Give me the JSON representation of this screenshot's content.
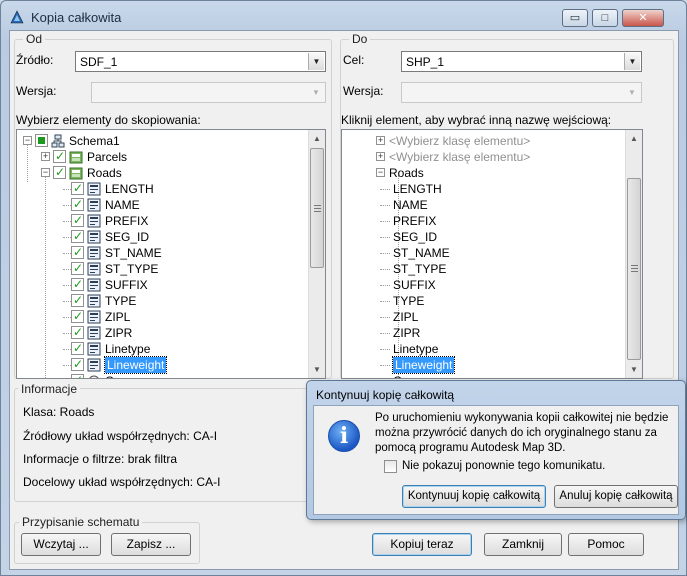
{
  "window": {
    "title": "Kopia całkowita",
    "minimize_glyph": "▭",
    "maximize_glyph": "□",
    "close_glyph": "✕"
  },
  "left": {
    "group_label": "Od",
    "source_label": "Źródło:",
    "source_value": "SDF_1",
    "version_label": "Wersja:",
    "version_value": "",
    "tree_label": "Wybierz elementy do skopiowania:",
    "tree_items": [
      {
        "label": "Schema1",
        "level": 0,
        "expander": "−",
        "check": "partial",
        "icon": "schema-icon"
      },
      {
        "label": "Parcels",
        "level": 1,
        "expander": "+",
        "check": "checked",
        "icon": "feature-class-icon"
      },
      {
        "label": "Roads",
        "level": 1,
        "expander": "−",
        "check": "checked",
        "icon": "feature-class-icon"
      },
      {
        "label": "LENGTH",
        "level": 2,
        "check": "checked",
        "icon": "property-icon"
      },
      {
        "label": "NAME",
        "level": 2,
        "check": "checked",
        "icon": "property-icon"
      },
      {
        "label": "PREFIX",
        "level": 2,
        "check": "checked",
        "icon": "property-icon"
      },
      {
        "label": "SEG_ID",
        "level": 2,
        "check": "checked",
        "icon": "property-icon"
      },
      {
        "label": "ST_NAME",
        "level": 2,
        "check": "checked",
        "icon": "property-icon"
      },
      {
        "label": "ST_TYPE",
        "level": 2,
        "check": "checked",
        "icon": "property-icon"
      },
      {
        "label": "SUFFIX",
        "level": 2,
        "check": "checked",
        "icon": "property-icon"
      },
      {
        "label": "TYPE",
        "level": 2,
        "check": "checked",
        "icon": "property-icon"
      },
      {
        "label": "ZIPL",
        "level": 2,
        "check": "checked",
        "icon": "property-icon"
      },
      {
        "label": "ZIPR",
        "level": 2,
        "check": "checked",
        "icon": "property-icon"
      },
      {
        "label": "Linetype",
        "level": 2,
        "check": "checked",
        "icon": "property-icon"
      },
      {
        "label": "Lineweight",
        "level": 2,
        "check": "checked",
        "icon": "property-icon",
        "selected": true
      },
      {
        "label": "Geom",
        "level": 2,
        "check": "checked",
        "icon": "geometry-icon",
        "partial_visible": true
      }
    ]
  },
  "right": {
    "group_label": "Do",
    "target_label": "Cel:",
    "target_value": "SHP_1",
    "version_label": "Wersja:",
    "version_value": "",
    "tree_label": "Kliknij element, aby wybrać inną nazwę wejściową:",
    "tree_items": [
      {
        "label": "<Wybierz klasę elementu>",
        "level": 0,
        "expander": "+",
        "gray": true
      },
      {
        "label": "<Wybierz klasę elementu>",
        "level": 0,
        "expander": "+",
        "gray": true
      },
      {
        "label": "Roads",
        "level": 0,
        "expander": "−"
      },
      {
        "label": "LENGTH",
        "level": 1
      },
      {
        "label": "NAME",
        "level": 1
      },
      {
        "label": "PREFIX",
        "level": 1
      },
      {
        "label": "SEG_ID",
        "level": 1
      },
      {
        "label": "ST_NAME",
        "level": 1
      },
      {
        "label": "ST_TYPE",
        "level": 1
      },
      {
        "label": "SUFFIX",
        "level": 1
      },
      {
        "label": "TYPE",
        "level": 1
      },
      {
        "label": "ZIPL",
        "level": 1
      },
      {
        "label": "ZIPR",
        "level": 1
      },
      {
        "label": "Linetype",
        "level": 1
      },
      {
        "label": "Lineweight",
        "level": 1,
        "selected": true
      },
      {
        "label": "Geom",
        "level": 1,
        "partial_visible": true
      }
    ]
  },
  "info": {
    "group_label": "Informacje",
    "class_line": "Klasa: Roads",
    "source_cs_line": "Źródłowy układ współrzędnych: CA-I",
    "filter_line": "Informacje o filtrze: brak filtra",
    "target_cs_line": "Docelowy układ współrzędnych: CA-I"
  },
  "schema_mapping": {
    "group_label": "Przypisanie schematu",
    "load_button": "Wczytaj ...",
    "save_button": "Zapisz ..."
  },
  "footer": {
    "copy_now_button": "Kopiuj teraz",
    "close_button": "Zamknij",
    "help_button": "Pomoc"
  },
  "popup": {
    "title": "Kontynuuj kopię całkowitą",
    "message": "Po uruchomieniu wykonywania kopii całkowitej nie będzie można przywrócić danych do ich oryginalnego stanu za pomocą programu Autodesk Map 3D.",
    "dont_show_label": "Nie pokazuj ponownie tego komunikatu.",
    "dont_show_checked": false,
    "continue_button": "Kontynuuj kopię całkowitą",
    "cancel_button": "Anuluj kopię całkowitą",
    "icon": "info-icon"
  },
  "colors": {
    "check_green": "#1d9a1d",
    "selection_blue": "#3399ff",
    "title_blue": "#c9d8ea"
  }
}
